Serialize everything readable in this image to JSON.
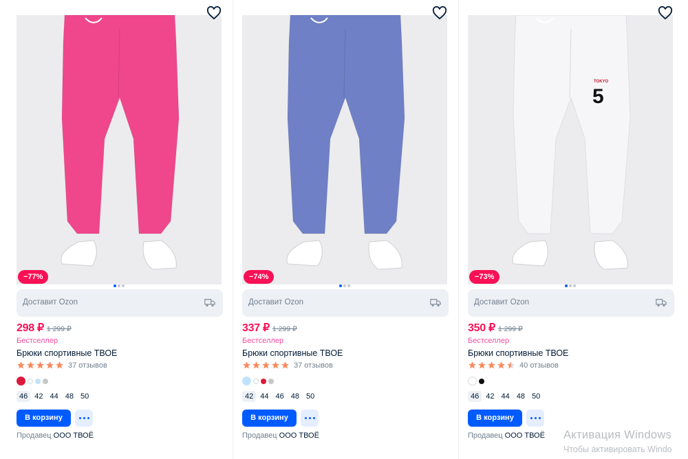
{
  "products": [
    {
      "color": "#f0478c",
      "discount": "−77%",
      "delivery": "Доставит Ozon",
      "price": "298 ₽",
      "old_price": "1 299 ₽",
      "bestseller": "Бестселлер",
      "title": "Брюки спортивные ТВОЕ",
      "rating": 5,
      "reviews": "37 отзывов",
      "swatches": [
        "#dc1a3b",
        "#ffffff",
        "#bfe3fb",
        "#c7c7c7"
      ],
      "sizes": [
        "46",
        "42",
        "44",
        "48",
        "50"
      ],
      "cart_label": "В корзину",
      "seller_label": "Продавец",
      "seller_name": "ООО ТВОЁ"
    },
    {
      "color": "#6f80c6",
      "discount": "−74%",
      "delivery": "Доставит Ozon",
      "price": "337 ₽",
      "old_price": "1 299 ₽",
      "bestseller": "Бестселлер",
      "title": "Брюки спортивные ТВОЕ",
      "rating": 5,
      "reviews": "37 отзывов",
      "swatches": [
        "#bfe3fb",
        "#ffffff",
        "#dc1a3b",
        "#c7c7c7"
      ],
      "sizes": [
        "42",
        "44",
        "46",
        "48",
        "50"
      ],
      "cart_label": "В корзину",
      "seller_label": "Продавец",
      "seller_name": "ООО ТВОЁ"
    },
    {
      "color": "#f6f6f8",
      "discount": "−73%",
      "delivery": "Доставит Ozon",
      "price": "350 ₽",
      "old_price": "1 299 ₽",
      "bestseller": "Бестселлер",
      "title": "Брюки спортивные ТВОЕ",
      "rating": 4.5,
      "reviews": "40 отзывов",
      "swatches": [
        "#ffffff",
        "#111111"
      ],
      "sizes": [
        "46",
        "42",
        "44",
        "48",
        "50"
      ],
      "cart_label": "В корзину",
      "seller_label": "Продавец",
      "seller_name": "ООО ТВОЁ",
      "print_text": "TOKYO",
      "print_number": "5"
    }
  ],
  "watermark": {
    "line1": "Активация Windows",
    "line2": "Чтобы активировать Windo"
  }
}
